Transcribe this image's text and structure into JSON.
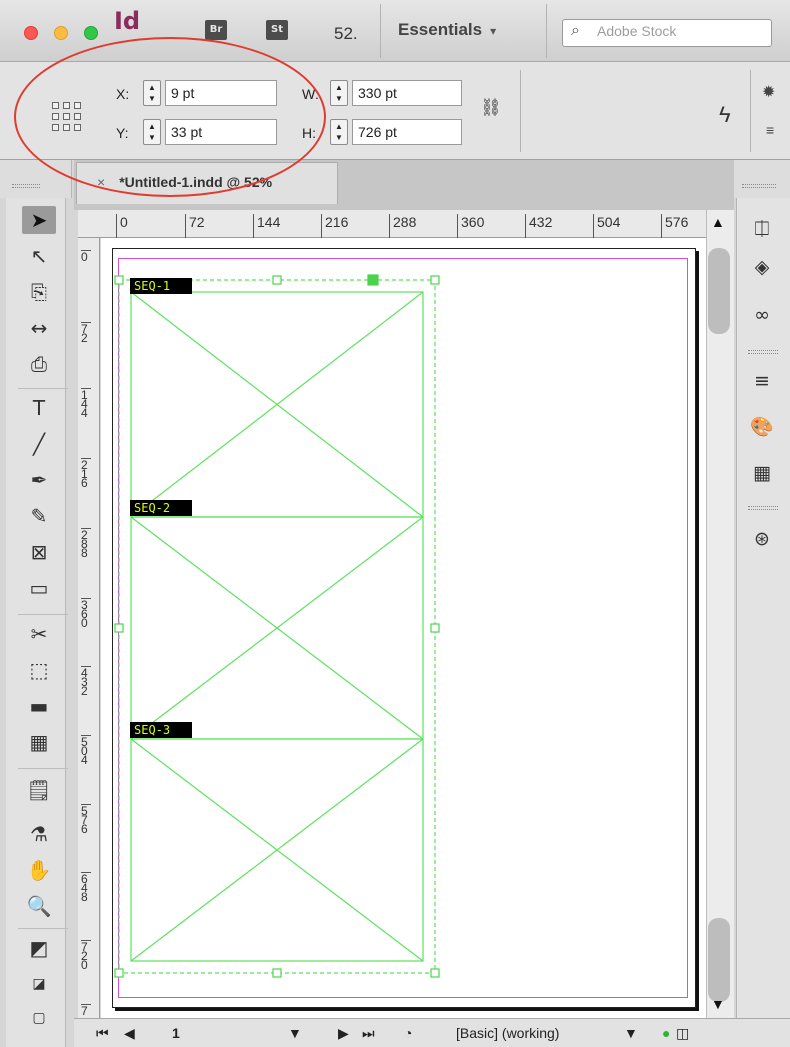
{
  "app": {
    "logo_text": "Id",
    "bridge_label": "Br",
    "stock_label": "St",
    "zoom_display": "52.",
    "workspace_label": "Essentials",
    "workspace_caret": "▾",
    "stock_search_placeholder": "Adobe Stock"
  },
  "control_panel": {
    "x_label": "X:",
    "x_value": "9 pt",
    "y_label": "Y:",
    "y_value": "33 pt",
    "w_label": "W:",
    "w_value": "330 pt",
    "h_label": "H:",
    "h_value": "726 pt"
  },
  "document": {
    "tab_title": "*Untitled-1.indd @ 52%",
    "tab_close": "×"
  },
  "ruler": {
    "horizontal_ticks": [
      "0",
      "72",
      "144",
      "216",
      "288",
      "360",
      "432",
      "504",
      "576"
    ],
    "vertical_ticks": [
      "0",
      "7\n2",
      "1\n4\n4",
      "2\n1\n6",
      "2\n8\n8",
      "3\n6\n0",
      "4\n3\n2",
      "5\n0\n4",
      "5\n7\n6",
      "6\n4\n8",
      "7\n2\n0",
      "7"
    ]
  },
  "frames": {
    "labels": [
      "SEQ-1",
      "SEQ-2",
      "SEQ-3"
    ],
    "frame_color": "#5be35b",
    "margin_color": "#d34fdd",
    "label_text_color": "#d6ff00"
  },
  "status_bar": {
    "page_number": "1",
    "preflight_profile": "[Basic] (working)"
  },
  "annotation_color": "#e13a2f"
}
